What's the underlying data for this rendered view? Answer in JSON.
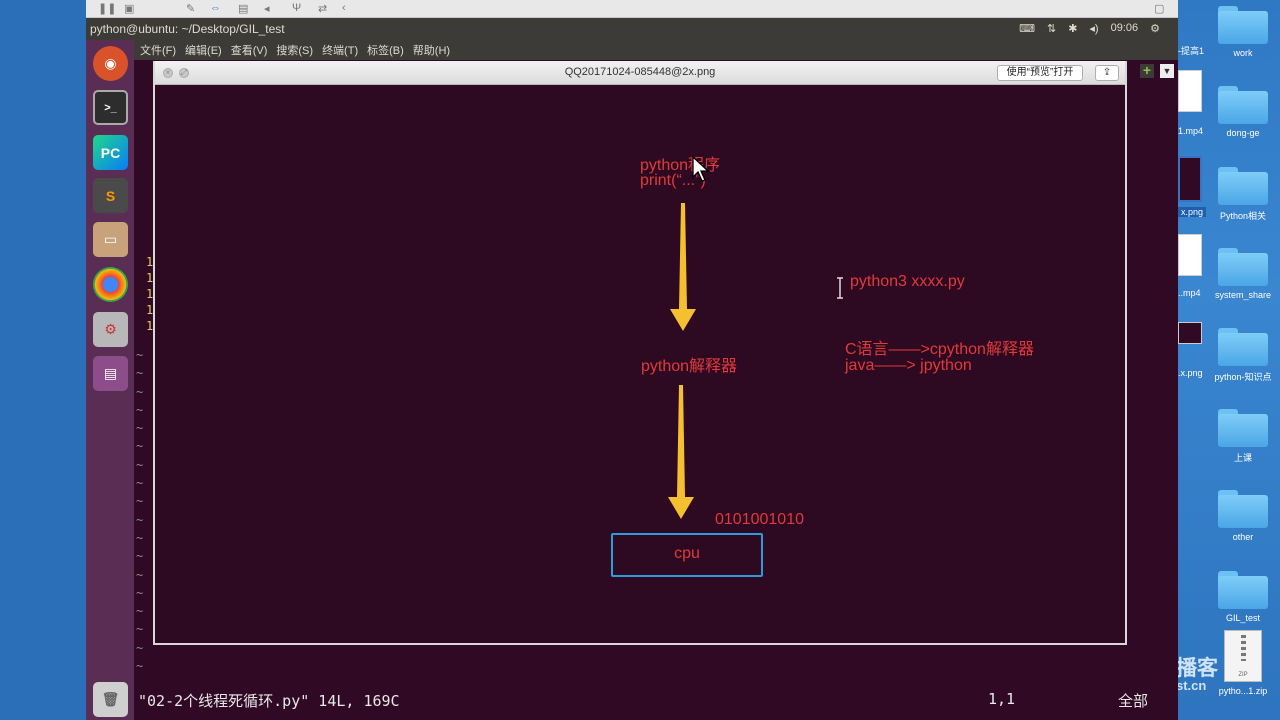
{
  "window": {
    "title": "python@ubuntu: ~/Desktop/GIL_test",
    "clock": "09:06"
  },
  "menu": [
    "文件(F)",
    "编辑(E)",
    "查看(V)",
    "搜索(S)",
    "终端(T)",
    "标签(B)",
    "帮助(H)"
  ],
  "preview": {
    "filename": "QQ20171024-085448@2x.png",
    "open_button": "使用“预览”打开",
    "diagram": {
      "program_label": "python程序",
      "program_code": "print(“...”)",
      "run_cmd": "python3 xxxx.py",
      "interpreter": "python解释器",
      "c_note": "C语言——>cpython解释器",
      "java_note": "java——> jpython",
      "binary": "0101001010",
      "cpu": "cpu"
    }
  },
  "terminal": {
    "status_file": "\"02-2个线程死循环.py\" 14L, 169C",
    "status_pos": "1,1",
    "status_pct": "全部",
    "gutter": [
      "~",
      "~",
      "~",
      "~",
      "~",
      "~",
      "~",
      "~",
      "~",
      "~",
      "~",
      "~",
      "~",
      "~",
      "~",
      "~",
      "~",
      "~"
    ],
    "line_numbers": [
      "1",
      "1",
      "1",
      "1",
      "1"
    ]
  },
  "desktop": {
    "items": [
      "work",
      "dong-ge",
      "Python相关",
      "system_share",
      "python-知识点",
      "上课",
      "other",
      "GIL_test",
      "pytho...1.zip"
    ],
    "partial_items": [
      "-提高1",
      "1.mp4",
      "x.png",
      "..mp4",
      ".x.png"
    ],
    "watermark": "播客",
    "watermark2": "st.cn"
  },
  "colors": {
    "terminal_bg": "#300a24",
    "diagram_text": "#e03a3a",
    "arrow": "#f5c030",
    "cpu_box": "#2f9bd8"
  }
}
